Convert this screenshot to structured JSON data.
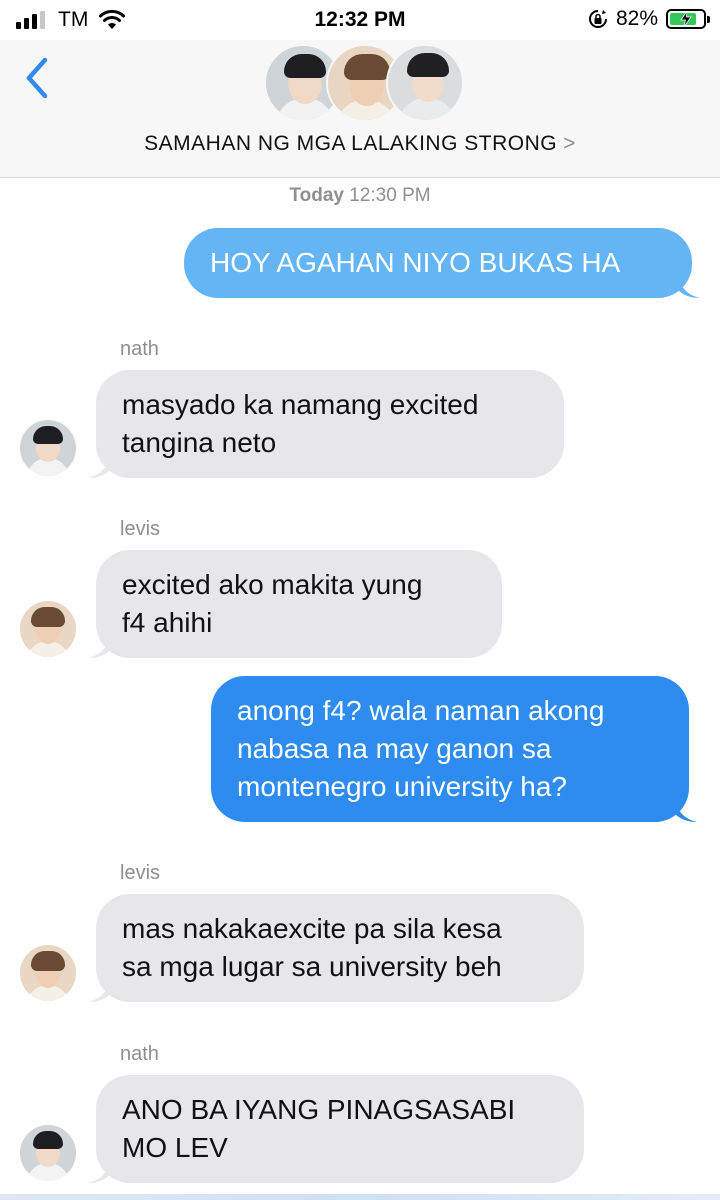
{
  "status_bar": {
    "carrier": "TM",
    "time": "12:32 PM",
    "battery_percent": "82%",
    "battery_level": 0.82,
    "signal_bars": 4,
    "signal_active": 3,
    "colors": {
      "battery": "#34c759"
    },
    "icons": [
      "signal-icon",
      "wifi-icon",
      "orientation-lock-icon",
      "battery-charging-icon"
    ]
  },
  "header": {
    "back_icon": "chevron-left-icon",
    "title": "SAMAHAN NG MGA LALAKING STRONG",
    "title_chevron": ">",
    "group_avatars": [
      "avatar-1",
      "avatar-2",
      "avatar-3"
    ]
  },
  "conversation": {
    "timestamp_day": "Today",
    "timestamp_time": "12:30 PM",
    "messages": [
      {
        "direction": "outgoing",
        "lines": [
          "HOY AGAHAN NIYO BUKAS HA"
        ]
      },
      {
        "direction": "incoming",
        "sender": "nath",
        "lines": [
          "masyado ka namang excited",
          "tangina neto"
        ]
      },
      {
        "direction": "incoming",
        "sender": "levis",
        "lines": [
          "excited ako makita yung",
          "f4 ahihi"
        ]
      },
      {
        "direction": "outgoing",
        "lines": [
          "anong f4? wala naman akong",
          "nabasa na may ganon sa",
          "montenegro university ha?"
        ]
      },
      {
        "direction": "incoming",
        "sender": "levis",
        "lines": [
          "mas nakakaexcite pa sila kesa",
          "sa mga lugar sa university beh"
        ]
      },
      {
        "direction": "incoming",
        "sender": "nath",
        "lines": [
          "ANO BA IYANG PINAGSASABI",
          "MO LEV"
        ]
      }
    ]
  },
  "colors": {
    "outgoing_bubble_first": "#64b5f6",
    "outgoing_bubble": "#2e8cf0",
    "incoming_bubble": "#e6e6eb",
    "accent": "#2e8cf0"
  }
}
